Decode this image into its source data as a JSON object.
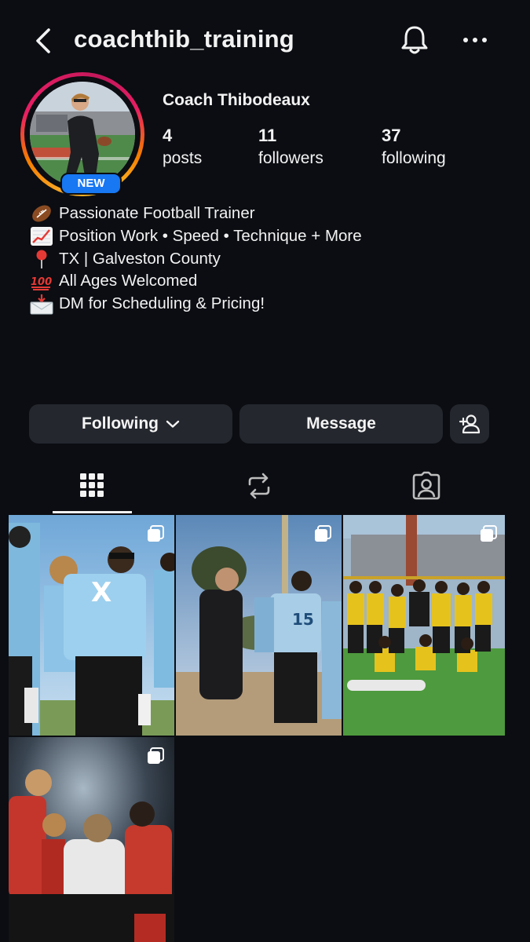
{
  "header": {
    "username": "coachthib_training"
  },
  "profile": {
    "display_name": "Coach Thibodeaux",
    "badge": "NEW",
    "stats": [
      {
        "value": "4",
        "label": "posts"
      },
      {
        "value": "11",
        "label": "followers"
      },
      {
        "value": "37",
        "label": "following"
      }
    ],
    "bio": [
      {
        "icon": "football-icon",
        "text": "Passionate Football Trainer"
      },
      {
        "icon": "chart-increasing-icon",
        "text": "Position Work • Speed • Technique + More"
      },
      {
        "icon": "round-pushpin-icon",
        "text": "TX | Galveston County"
      },
      {
        "icon": "hundred-points-icon",
        "text": "All Ages Welcomed"
      },
      {
        "icon": "envelope-arrow-icon",
        "text": "DM for Scheduling & Pricing!"
      }
    ]
  },
  "actions": {
    "following_label": "Following",
    "message_label": "Message"
  },
  "tabs": [
    "grid-icon",
    "reposts-icon",
    "tagged-icon"
  ],
  "posts": [
    {
      "id": "post-1",
      "type": "carousel"
    },
    {
      "id": "post-2",
      "type": "carousel"
    },
    {
      "id": "post-3",
      "type": "carousel"
    },
    {
      "id": "post-4",
      "type": "carousel"
    }
  ],
  "colors": {
    "background": "#0b0d12",
    "button": "#24272e",
    "text": "#f2f2f2",
    "badge": "#1877f2"
  }
}
